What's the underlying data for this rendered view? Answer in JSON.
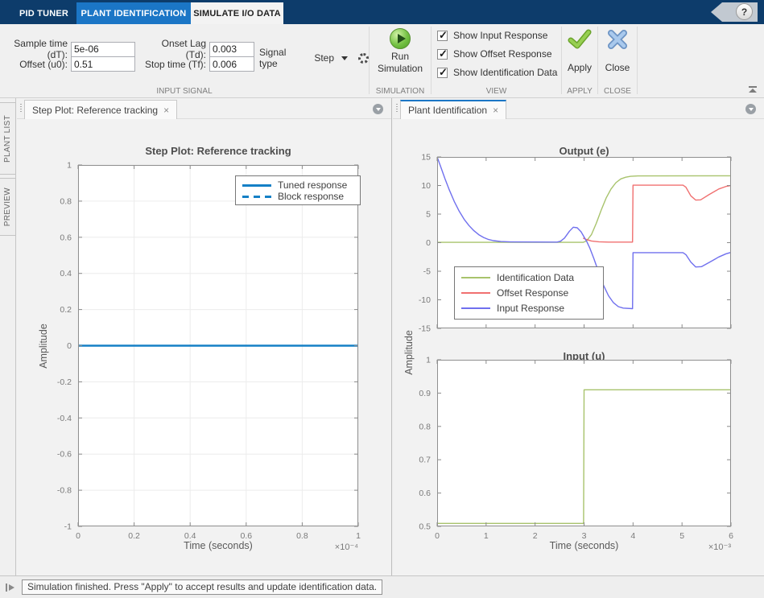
{
  "header": {
    "tabs": [
      {
        "label": "PID TUNER"
      },
      {
        "label": "PLANT IDENTIFICATION"
      },
      {
        "label": "SIMULATE I/O DATA"
      }
    ],
    "help_glyph": "?"
  },
  "toolbar": {
    "input_signal": {
      "section_label": "INPUT SIGNAL",
      "fields": [
        {
          "label": "Sample time (dT):",
          "value": "5e-06"
        },
        {
          "label": "Offset (u0):",
          "value": "0.51"
        },
        {
          "label": "Onset Lag (Td):",
          "value": "0.003"
        },
        {
          "label": "Stop time (Tf):",
          "value": "0.006"
        }
      ],
      "signal_type_label": "Signal type",
      "signal_type_value": "Step"
    },
    "simulation": {
      "section_label": "SIMULATION",
      "button_line1": "Run",
      "button_line2": "Simulation"
    },
    "view": {
      "section_label": "VIEW",
      "checkboxes": [
        {
          "label": "Show Input Response",
          "checked": true
        },
        {
          "label": "Show Offset Response",
          "checked": true
        },
        {
          "label": "Show Identification Data",
          "checked": true
        }
      ]
    },
    "apply": {
      "section_label": "APPLY",
      "button_label": "Apply"
    },
    "close": {
      "section_label": "CLOSE",
      "button_label": "Close"
    }
  },
  "left_rail": {
    "tabs": [
      {
        "label": "PLANT LIST"
      },
      {
        "label": "PREVIEW"
      }
    ]
  },
  "left_doc": {
    "tab_title": "Step Plot: Reference tracking",
    "close_glyph": "×"
  },
  "right_doc": {
    "tab_title": "Plant Identification",
    "close_glyph": "×"
  },
  "statusbar": {
    "message": "Simulation finished. Press \"Apply\" to accept results and update identification data."
  },
  "chart_data": [
    {
      "type": "line",
      "title": "Step Plot: Reference tracking",
      "xlabel": "Time (seconds)",
      "ylabel": "Amplitude",
      "x_multiplier": "×10⁻⁴",
      "xlim": [
        0,
        1
      ],
      "ylim": [
        -1,
        1
      ],
      "xticks": [
        "0",
        "0.2",
        "0.4",
        "0.6",
        "0.8",
        "1"
      ],
      "yticks": [
        "-1",
        "-0.8",
        "-0.6",
        "-0.4",
        "-0.2",
        "0",
        "0.2",
        "0.4",
        "0.6",
        "0.8",
        "1"
      ],
      "grid": true,
      "legend_position": "top-right",
      "legend": [
        {
          "label": "Tuned response",
          "color": "#1580c6",
          "width": 3,
          "dash": false
        },
        {
          "label": "Block response",
          "color": "#1580c6",
          "width": 3,
          "dash": true
        }
      ],
      "series": [
        {
          "name": "Tuned response",
          "color": "#1580c6",
          "width": 2.4,
          "points": [
            [
              0,
              0
            ],
            [
              1,
              0
            ]
          ]
        }
      ]
    },
    {
      "type": "line",
      "title": "Output (e)",
      "xlim": [
        0,
        6
      ],
      "ylim": [
        -15,
        15
      ],
      "xticks": [
        "0",
        "1",
        "2",
        "3",
        "4",
        "5",
        "6"
      ],
      "xtick_labels": false,
      "yticks": [
        "-15",
        "-10",
        "-5",
        "0",
        "5",
        "10",
        "15"
      ],
      "grid": false,
      "legend_position": "bottom-left",
      "legend": [
        {
          "label": "Identification Data",
          "color": "#a8c36c",
          "width": 2,
          "dash": false
        },
        {
          "label": "Offset Response",
          "color": "#f07070",
          "width": 2,
          "dash": false
        },
        {
          "label": "Input Response",
          "color": "#7070ee",
          "width": 2,
          "dash": false
        }
      ],
      "series": [
        {
          "name": "Identification Data",
          "color": "#a8c36c",
          "width": 1.4,
          "points": [
            [
              0,
              0.05
            ],
            [
              2.98,
              0.05
            ],
            [
              3.05,
              0.3
            ],
            [
              3.15,
              1.4
            ],
            [
              3.25,
              3.4
            ],
            [
              3.35,
              5.7
            ],
            [
              3.45,
              7.8
            ],
            [
              3.55,
              9.4
            ],
            [
              3.65,
              10.5
            ],
            [
              3.75,
              11.15
            ],
            [
              3.85,
              11.45
            ],
            [
              3.95,
              11.6
            ],
            [
              4.1,
              11.68
            ],
            [
              6,
              11.7
            ]
          ]
        },
        {
          "name": "Offset Response",
          "color": "#f07070",
          "width": 1.4,
          "points": [
            [
              2.98,
              0.8
            ],
            [
              3.05,
              0.55
            ],
            [
              3.15,
              0.3
            ],
            [
              3.3,
              0.15
            ],
            [
              3.5,
              0.1
            ],
            [
              3.99,
              0.1
            ],
            [
              4.0,
              10.05
            ],
            [
              5.02,
              10.05
            ],
            [
              5.08,
              9.7
            ],
            [
              5.18,
              8.2
            ],
            [
              5.28,
              7.45
            ],
            [
              5.38,
              7.5
            ],
            [
              5.55,
              8.4
            ],
            [
              5.75,
              9.4
            ],
            [
              5.9,
              9.85
            ],
            [
              6,
              10.0
            ]
          ]
        },
        {
          "name": "Input Response",
          "color": "#7070ee",
          "width": 1.4,
          "points": [
            [
              0,
              15
            ],
            [
              0.08,
              13.1
            ],
            [
              0.16,
              11.2
            ],
            [
              0.25,
              9.2
            ],
            [
              0.35,
              7.2
            ],
            [
              0.45,
              5.5
            ],
            [
              0.55,
              4.1
            ],
            [
              0.65,
              3.0
            ],
            [
              0.75,
              2.1
            ],
            [
              0.85,
              1.4
            ],
            [
              0.95,
              0.9
            ],
            [
              1.05,
              0.55
            ],
            [
              1.15,
              0.35
            ],
            [
              1.3,
              0.2
            ],
            [
              1.5,
              0.12
            ],
            [
              2.45,
              0.1
            ],
            [
              2.52,
              0.25
            ],
            [
              2.6,
              0.8
            ],
            [
              2.7,
              2.0
            ],
            [
              2.78,
              2.7
            ],
            [
              2.86,
              2.6
            ],
            [
              2.94,
              1.9
            ],
            [
              3.0,
              1.0
            ],
            [
              3.06,
              0.1
            ],
            [
              3.12,
              -1.0
            ],
            [
              3.2,
              -2.8
            ],
            [
              3.3,
              -5.2
            ],
            [
              3.4,
              -7.5
            ],
            [
              3.5,
              -9.3
            ],
            [
              3.6,
              -10.5
            ],
            [
              3.7,
              -11.2
            ],
            [
              3.8,
              -11.45
            ],
            [
              3.99,
              -11.55
            ],
            [
              4.0,
              -1.75
            ],
            [
              5.02,
              -1.75
            ],
            [
              5.08,
              -2.1
            ],
            [
              5.18,
              -3.4
            ],
            [
              5.28,
              -4.25
            ],
            [
              5.4,
              -4.2
            ],
            [
              5.55,
              -3.5
            ],
            [
              5.75,
              -2.5
            ],
            [
              5.9,
              -1.95
            ],
            [
              6,
              -1.7
            ]
          ]
        }
      ]
    },
    {
      "type": "line",
      "title": "Input (u)",
      "xlabel": "Time (seconds)",
      "ylabel": "Amplitude",
      "x_multiplier": "×10⁻³",
      "xlim": [
        0,
        6
      ],
      "ylim": [
        0.5,
        1
      ],
      "xticks": [
        "0",
        "1",
        "2",
        "3",
        "4",
        "5",
        "6"
      ],
      "yticks": [
        "0.5",
        "0.6",
        "0.7",
        "0.8",
        "0.9",
        "1"
      ],
      "grid": false,
      "series": [
        {
          "name": "Input step",
          "color": "#a8c36c",
          "width": 1.4,
          "points": [
            [
              0,
              0.509
            ],
            [
              2.99,
              0.509
            ],
            [
              3.0,
              0.91
            ],
            [
              6,
              0.91
            ]
          ]
        }
      ]
    }
  ],
  "colors": {
    "header_bg": "#0d3c6b",
    "highlight_tab_bg": "#1b76c6",
    "tuned_blue": "#1580c6",
    "identification_green": "#a8c36c",
    "offset_red": "#f07070",
    "input_blue": "#7070ee"
  }
}
